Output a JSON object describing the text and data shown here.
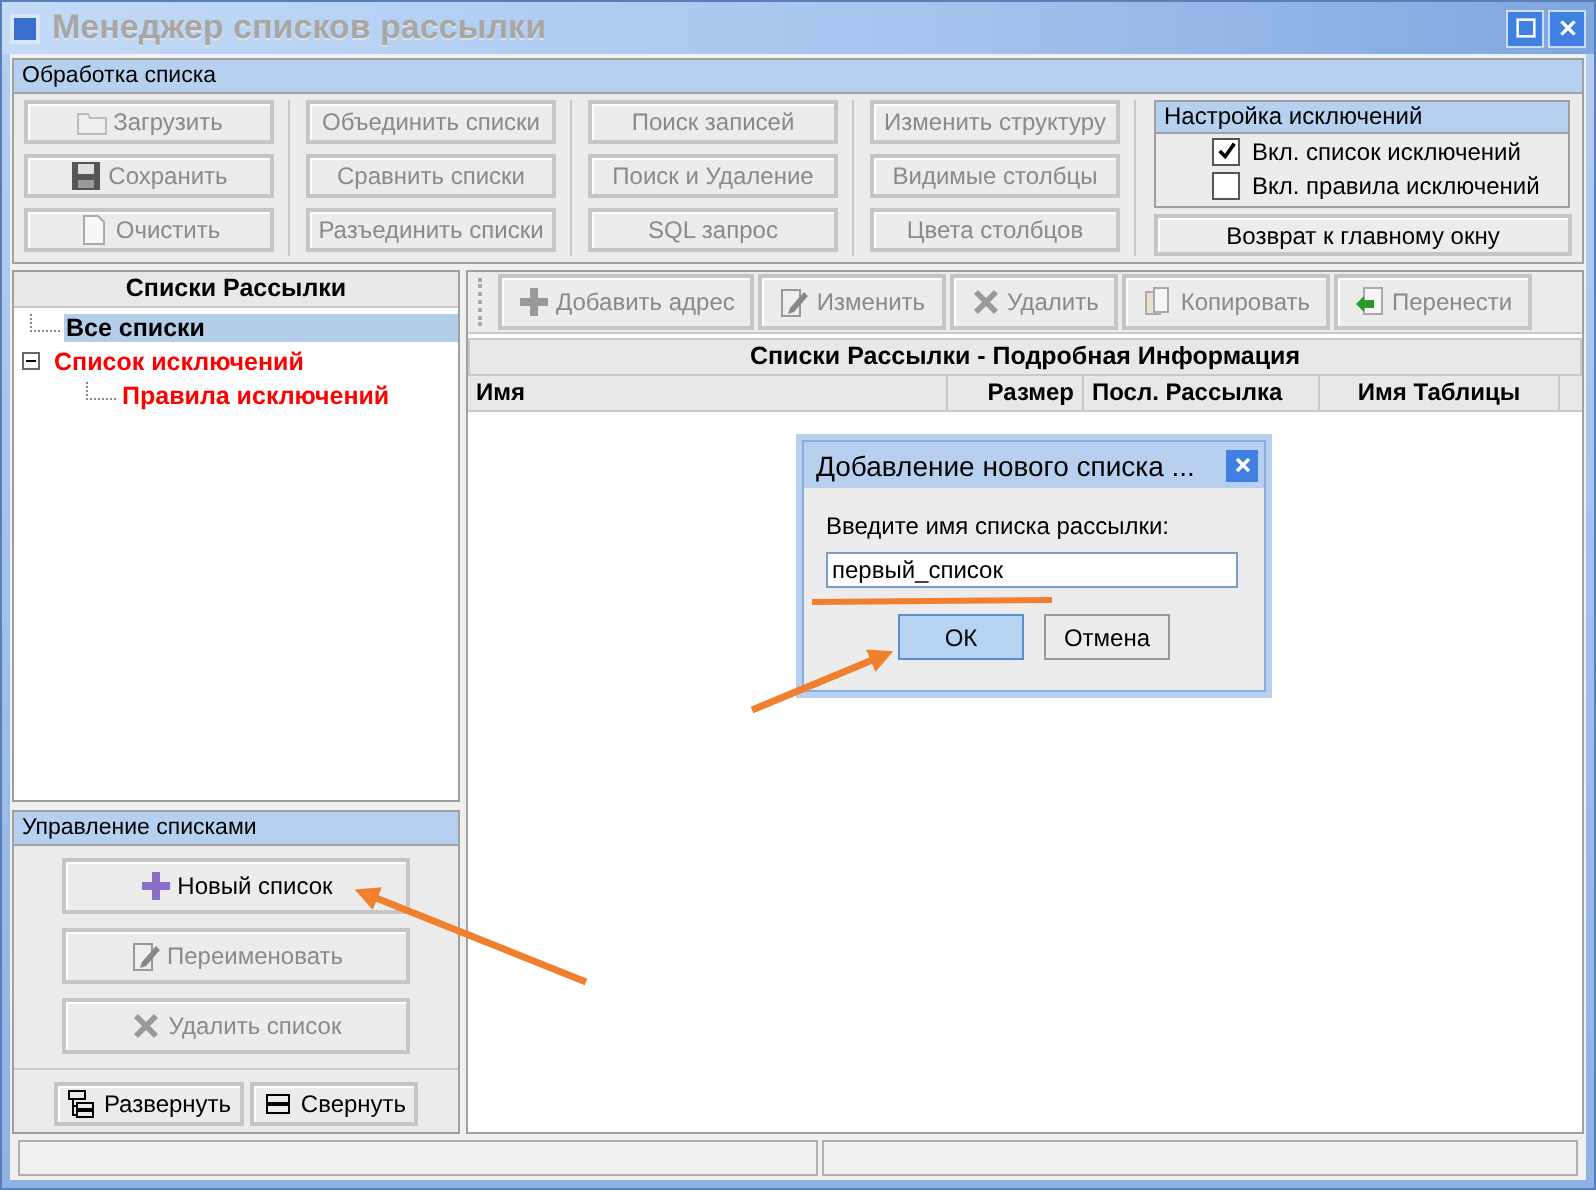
{
  "window": {
    "title": "Менеджер списков рассылки"
  },
  "processing": {
    "title": "Обработка списка",
    "columns": [
      [
        {
          "label": "Загрузить",
          "kind": "folder",
          "disabled": true
        },
        {
          "label": "Сохранить",
          "kind": "save",
          "disabled": true
        },
        {
          "label": "Очистить",
          "kind": "document",
          "disabled": true
        }
      ],
      [
        {
          "label": "Объединить списки",
          "kind": "plain",
          "disabled": true
        },
        {
          "label": "Сравнить списки",
          "kind": "plain",
          "disabled": true
        },
        {
          "label": "Разъединить списки",
          "kind": "plain",
          "disabled": true
        }
      ],
      [
        {
          "label": "Поиск записей",
          "kind": "plain",
          "disabled": true
        },
        {
          "label": "Поиск и Удаление",
          "kind": "plain",
          "disabled": true
        },
        {
          "label": "SQL запрос",
          "kind": "plain",
          "disabled": true
        }
      ],
      [
        {
          "label": "Изменить структуру",
          "kind": "plain",
          "disabled": true
        },
        {
          "label": "Видимые столбцы",
          "kind": "plain",
          "disabled": true
        },
        {
          "label": "Цвета столбцов",
          "kind": "plain",
          "disabled": true
        }
      ]
    ],
    "exclusions": {
      "title": "Настройка исключений",
      "options": [
        {
          "label": "Вкл. список исключений",
          "checked": true
        },
        {
          "label": "Вкл. правила исключений",
          "checked": false
        }
      ],
      "return_button": {
        "label": "Возврат к главному окну",
        "disabled": false
      }
    }
  },
  "lists": {
    "title": "Списки Рассылки",
    "tree": [
      {
        "label": "Все списки",
        "selected": true,
        "color": "#000000"
      },
      {
        "label": "Список исключений",
        "selected": false,
        "color": "#ff0000",
        "expanded": true,
        "children": [
          {
            "label": "Правила исключений",
            "selected": false,
            "color": "#ff0000"
          }
        ]
      }
    ]
  },
  "management": {
    "title": "Управление списками",
    "buttons": [
      {
        "label": "Новый список",
        "kind": "plus",
        "disabled": false
      },
      {
        "label": "Переименовать",
        "kind": "edit",
        "disabled": true
      },
      {
        "label": "Удалить список",
        "kind": "delete",
        "disabled": true
      }
    ],
    "tree_buttons": [
      {
        "label": "Развернуть",
        "kind": "expand",
        "disabled": false
      },
      {
        "label": "Свернуть",
        "kind": "collapse",
        "disabled": false
      }
    ]
  },
  "toolbar": [
    {
      "label": "Добавить адрес",
      "kind": "plus",
      "disabled": true
    },
    {
      "label": "Изменить",
      "kind": "edit",
      "disabled": true
    },
    {
      "label": "Удалить",
      "kind": "delete",
      "disabled": true
    },
    {
      "label": "Копировать",
      "kind": "copy",
      "disabled": true
    },
    {
      "label": "Перенести",
      "kind": "move",
      "disabled": true
    }
  ],
  "table": {
    "title": "Списки Рассылки - Подробная Информация",
    "columns": [
      "Имя",
      "Размер",
      "Посл. Рассылка",
      "Имя Таблицы"
    ]
  },
  "dialog": {
    "title": "Добавление нового списка ...",
    "prompt": "Введите имя списка рассылки:",
    "value": "первый_список",
    "buttons": [
      {
        "label": "ОК",
        "focused": true
      },
      {
        "label": "Отмена",
        "focused": false
      }
    ]
  }
}
